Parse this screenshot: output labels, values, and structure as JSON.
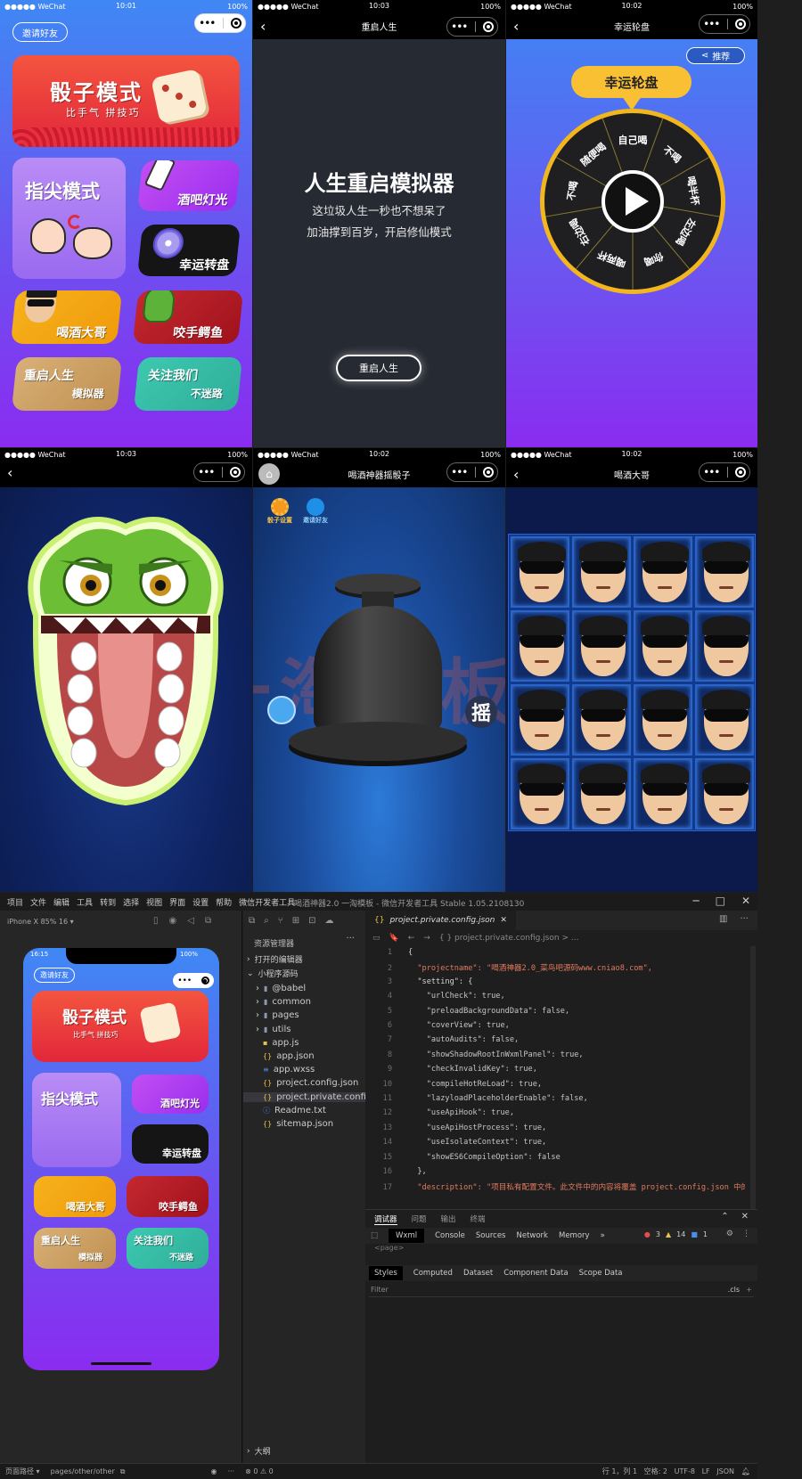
{
  "status_bar": {
    "carrier": "●●●●● WeChat",
    "battery": "100%"
  },
  "p1": {
    "time": "10:01",
    "invite_label": "邀请好友",
    "dice_title": "骰子模式",
    "dice_sub": "比手气 拼技巧",
    "finger_title": "指尖模式",
    "bar_light": "酒吧灯光",
    "lucky_wheel": "幸运转盘",
    "drinking_boss": "喝酒大哥",
    "croc": "咬手鳄鱼",
    "restart_line1": "重启人生",
    "restart_line2": "模拟器",
    "follow_line1": "关注我们",
    "follow_line2": "不迷路"
  },
  "p2": {
    "time": "10:03",
    "nav_title": "重启人生",
    "heading": "人生重启模拟器",
    "line1": "这垃圾人生一秒也不想呆了",
    "line2": "加油撑到百岁，开启修仙模式",
    "button": "重启人生"
  },
  "p3": {
    "time": "10:02",
    "nav_title": "幸运轮盘",
    "share_label": "推荐",
    "wheel_title": "幸运轮盘",
    "segments": [
      "自己喝",
      "不喝",
      "喝半杯",
      "左边喝",
      "你喝",
      "喝两杯",
      "右边喝",
      "不喝",
      "随便喝"
    ]
  },
  "p4": {
    "time": "10:03"
  },
  "p5": {
    "time": "10:02",
    "nav_title": "喝酒神器摇骰子",
    "dice_settings": "骰子设置",
    "invite": "邀请好友",
    "shake": "摇"
  },
  "p6": {
    "time": "10:02",
    "nav_title": "喝酒大哥"
  },
  "ide": {
    "menu": [
      "项目",
      "文件",
      "编辑",
      "工具",
      "转到",
      "选择",
      "视图",
      "界面",
      "设置",
      "帮助",
      "微信开发者工具"
    ],
    "window_title": "喝酒神器2.0 一淘模板 - 微信开发者工具 Stable 1.05.2108130",
    "device": "iPhone X 85% 16 ▾",
    "sim_time": "16:15",
    "explorer_title": "资源管理器",
    "open_editors": "打开的编辑器",
    "project_root": "小程序源码",
    "files": [
      "@babel",
      "common",
      "pages",
      "utils",
      "app.js",
      "app.json",
      "app.wxss",
      "project.config.json",
      "project.private.config.js...",
      "Readme.txt",
      "sitemap.json"
    ],
    "tab_name": "project.private.config.json",
    "breadcrumb": "{ } project.private.config.json > ...",
    "code": [
      {
        "n": "1",
        "t": "{"
      },
      {
        "n": "2",
        "t": "  \"projectname\": \"喝酒神器2.0_菜鸟吧源码www.cniao8.com\","
      },
      {
        "n": "3",
        "t": "  \"setting\": {"
      },
      {
        "n": "4",
        "t": "    \"urlCheck\": true,"
      },
      {
        "n": "5",
        "t": "    \"preloadBackgroundData\": false,"
      },
      {
        "n": "6",
        "t": "    \"coverView\": true,"
      },
      {
        "n": "7",
        "t": "    \"autoAudits\": false,"
      },
      {
        "n": "8",
        "t": "    \"showShadowRootInWxmlPanel\": true,"
      },
      {
        "n": "9",
        "t": "    \"checkInvalidKey\": true,"
      },
      {
        "n": "10",
        "t": "    \"compileHotReLoad\": true,"
      },
      {
        "n": "11",
        "t": "    \"lazyloadPlaceholderEnable\": false,"
      },
      {
        "n": "12",
        "t": "    \"useApiHook\": true,"
      },
      {
        "n": "13",
        "t": "    \"useApiHostProcess\": true,"
      },
      {
        "n": "14",
        "t": "    \"useIsolateContext\": true,"
      },
      {
        "n": "15",
        "t": "    \"showES6CompileOption\": false"
      },
      {
        "n": "16",
        "t": "  },"
      },
      {
        "n": "17",
        "t": "  \"description\": \"项目私有配置文件。此文件中的内容将覆盖 project.config.json 中的相同字"
      }
    ],
    "debug_tabs": [
      "调试器",
      "问题",
      "输出",
      "终端"
    ],
    "devtools_tabs": [
      "Wxml",
      "Console",
      "Sources",
      "Network",
      "Memory"
    ],
    "errors": "3",
    "warnings": "14",
    "info": "1",
    "styles_tabs": [
      "Styles",
      "Computed",
      "Dataset",
      "Component Data",
      "Scope Data"
    ],
    "filter": "Filter",
    "cls": ".cls",
    "outline": "大纲",
    "page_path_label": "页面路径 ▾",
    "page_path": "pages/other/other",
    "problems": "⊗ 0 ⚠ 0",
    "status_right": "行 1，列 1   空格: 2   UTF-8   LF   JSON"
  }
}
